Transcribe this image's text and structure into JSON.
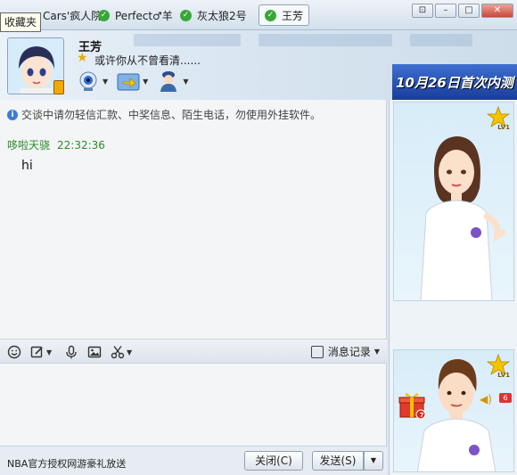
{
  "tooltip": "收藏夹",
  "tabs": [
    {
      "label": "Cars'疯人院"
    },
    {
      "label": "Perfect♂羊"
    },
    {
      "label": "灰太狼2号"
    },
    {
      "label": "王芳"
    }
  ],
  "window_buttons": [
    "⊡",
    "–",
    "□",
    "✕"
  ],
  "contact": {
    "name": "王芳",
    "signature": "或许你从不曾看清......"
  },
  "toolbar_icons": [
    "webcam-icon",
    "file-transfer-icon",
    "remote-assist-icon"
  ],
  "banner_ad": "10月26日首次内测",
  "chat": {
    "notice": "交谈中请勿轻信汇款、中奖信息、陌生电话，勿使用外挂软件。",
    "messages": [
      {
        "sender": "哆啦天骁",
        "time": "22:32:36",
        "text": "hi"
      }
    ]
  },
  "input_toolbar": {
    "icons": [
      "emoji-icon",
      "font-icon",
      "voice-icon",
      "image-icon",
      "screenshot-icon"
    ],
    "history_label": "消息记录"
  },
  "bottom": {
    "promo": "NBA官方授权网游豪礼放送",
    "close_label": "关闭(C)",
    "send_label": "发送(S)"
  },
  "side": {
    "level_label": "LV1",
    "gift_count": "7",
    "speaker_count": "6"
  },
  "colors": {
    "accent": "#3c7bd6",
    "sender": "#2a8a2a",
    "titlebar": "#d3e0ec"
  }
}
